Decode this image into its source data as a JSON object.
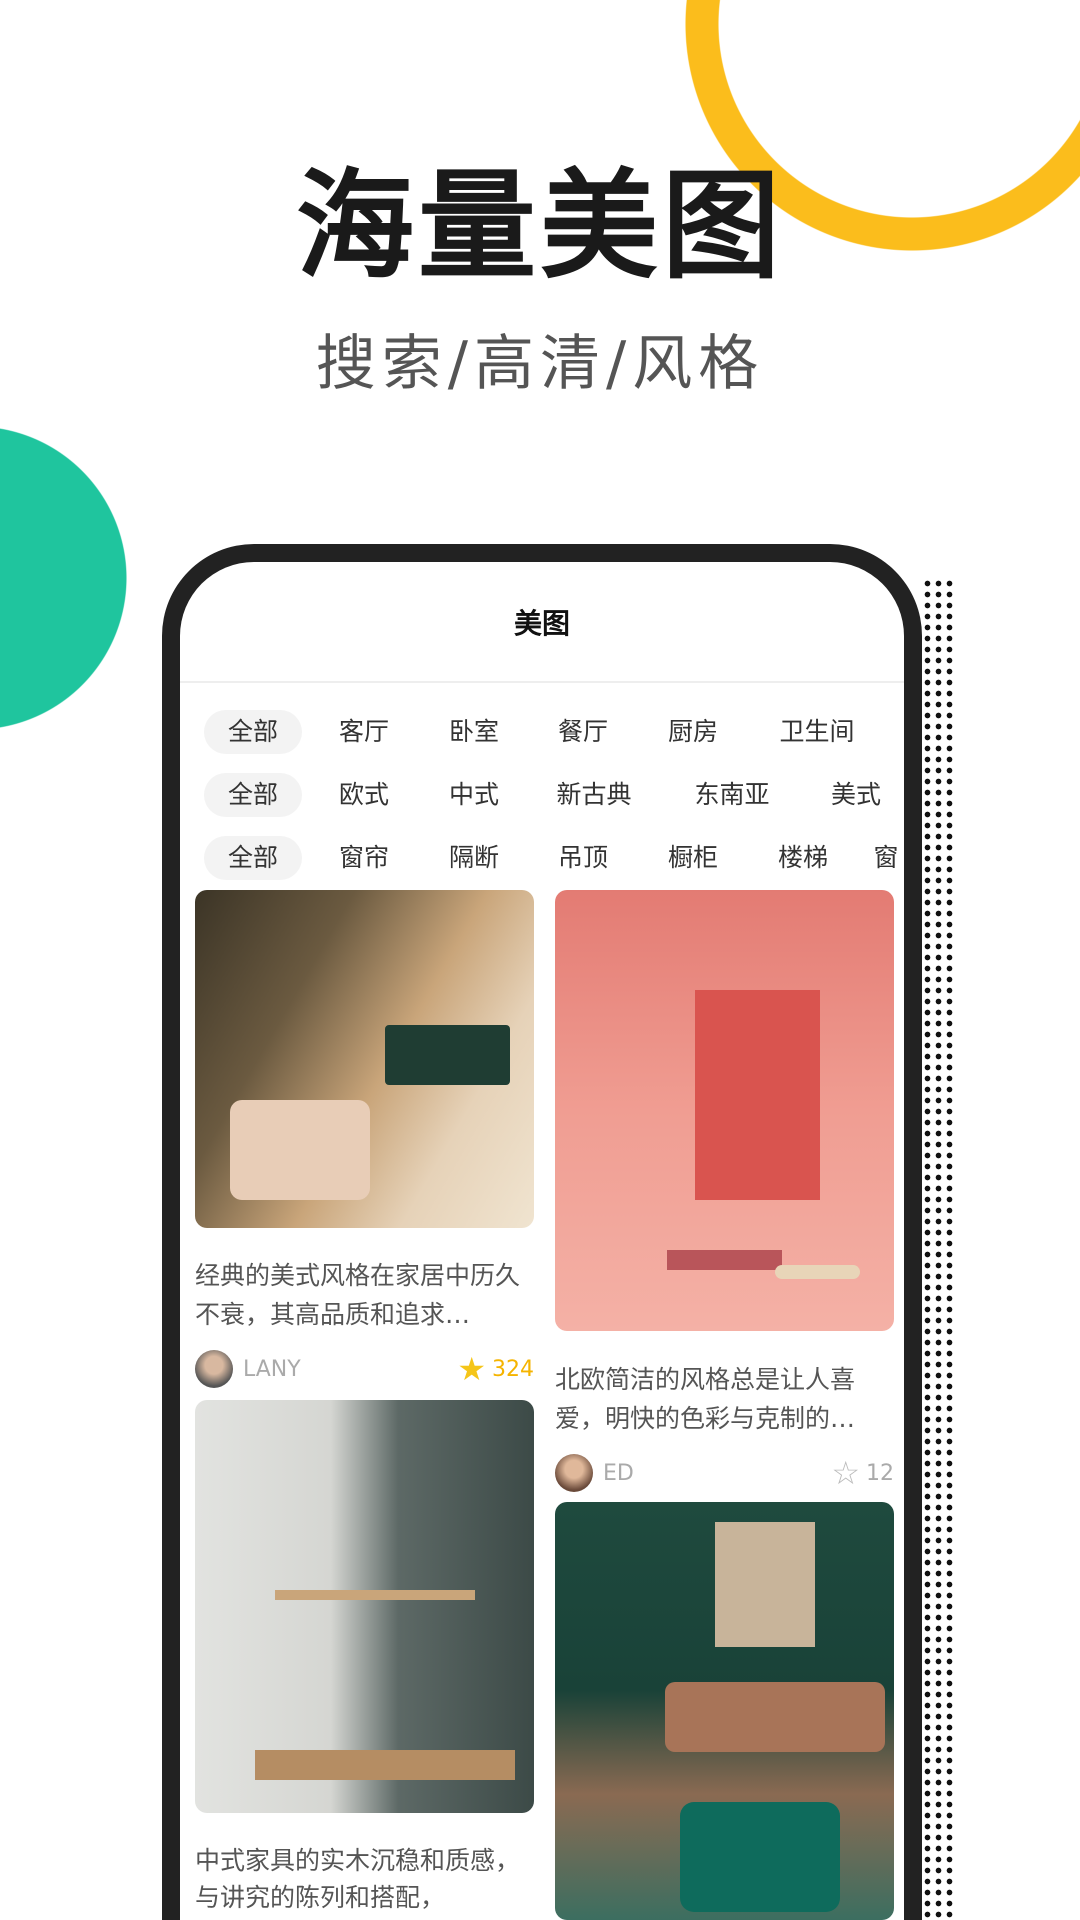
{
  "promo": {
    "title": "海量美图",
    "subtitle": "搜索/高清/风格"
  },
  "colors": {
    "ring": "#fbbd1c",
    "circle": "#1fc59e",
    "star_active": "#f5c518"
  },
  "screen": {
    "title": "美图"
  },
  "filters": [
    [
      "全部",
      "客厅",
      "卧室",
      "餐厅",
      "厨房",
      "卫生间"
    ],
    [
      "全部",
      "欧式",
      "中式",
      "新古典",
      "东南亚",
      "美式"
    ],
    [
      "全部",
      "窗帘",
      "隔断",
      "吊顶",
      "橱柜",
      "楼梯",
      "窗"
    ]
  ],
  "cards": [
    {
      "caption": "经典的美式风格在家居中历久不衰，其高品质和追求…",
      "author": "LANY",
      "likes": "324",
      "liked": true
    },
    {
      "caption": "北欧简洁的风格总是让人喜爱，明快的色彩与克制的…",
      "author": "ED",
      "likes": "12",
      "liked": false
    },
    {
      "caption": "中式家具的实木沉稳和质感，与讲究的陈列和搭配，"
    }
  ]
}
